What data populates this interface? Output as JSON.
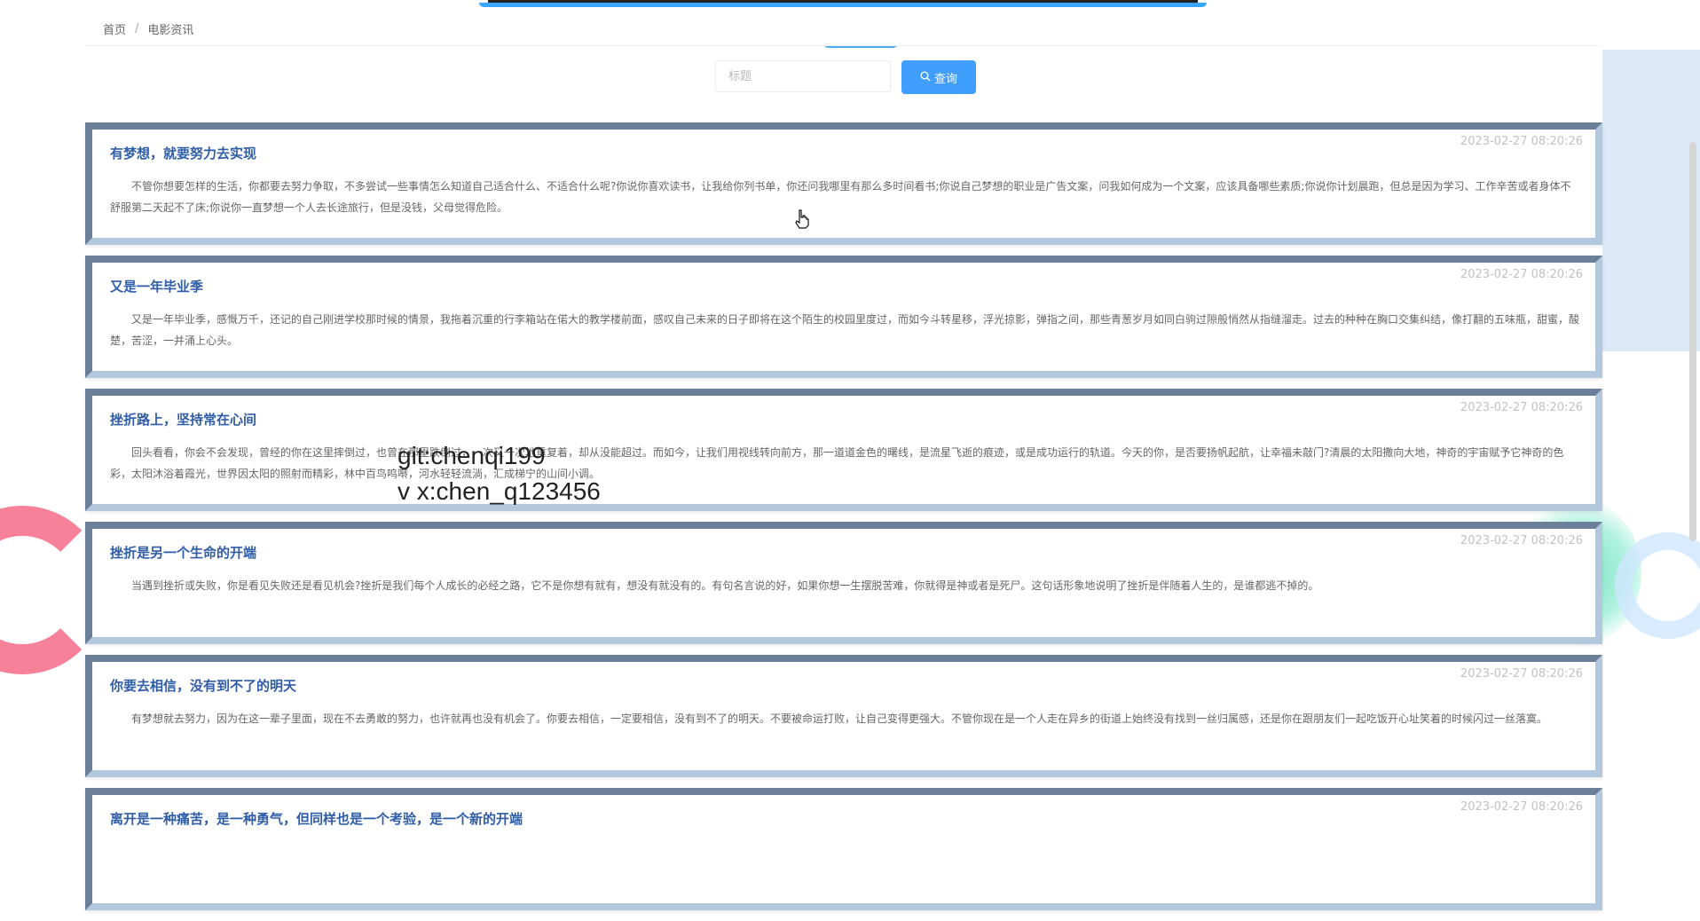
{
  "breadcrumb": {
    "home": "首页",
    "separator": "/",
    "current": "电影资讯"
  },
  "search": {
    "placeholder": "标题",
    "button_label": "查询",
    "button_icon": "search-icon"
  },
  "articles": [
    {
      "title": "有梦想，就要努力去实现",
      "time": "2023-02-27 08:20:26",
      "summary": "不管你想要怎样的生活，你都要去努力争取，不多尝试一些事情怎么知道自己适合什么、不适合什么呢?你说你喜欢读书，让我给你列书单，你还问我哪里有那么多时间看书;你说自己梦想的职业是广告文案，问我如何成为一个文案，应该具备哪些素质;你说你计划晨跑，但总是因为学习、工作辛苦或者身体不舒服第二天起不了床;你说你一直梦想一个人去长途旅行，但是没钱，父母觉得危险。"
    },
    {
      "title": "又是一年毕业季",
      "time": "2023-02-27 08:20:26",
      "summary": "又是一年毕业季，感慨万千，还记的自己刚进学校那时候的情景，我拖着沉重的行李箱站在偌大的教学楼前面，感叹自己未来的日子即将在这个陌生的校园里度过，而如今斗转星移，浮光掠影，弹指之间，那些青葱岁月如同白驹过隙般悄然从指缝溜走。过去的种种在胸口交集纠结，像打翻的五味瓶，甜蜜，酸楚，苦涩，一并涌上心头。"
    },
    {
      "title": "挫折路上，坚持常在心间",
      "time": "2023-02-27 08:20:26",
      "summary": "回头看看，你会不会发现，曾经的你在这里摔倒过，也曾在那里跌倒过，一次又一次地重复着，却从没能超过。而如今，让我们用视线转向前方，那一道道金色的曙线，是流星飞逝的痕迹，或是成功运行的轨道。今天的你，是否要扬帆起航，让幸福未敲门?清晨的太阳撒向大地，神奇的宇宙赋予它神奇的色彩，太阳沐浴着霞光，世界因太阳的照射而精彩，林中百鸟鸣啭，河水轻轻流淌，汇成梯宁的山间小调。"
    },
    {
      "title": "挫折是另一个生命的开端",
      "time": "2023-02-27 08:20:26",
      "summary": "当遇到挫折或失败，你是看见失败还是看见机会?挫折是我们每个人成长的必经之路，它不是你想有就有，想没有就没有的。有句名言说的好，如果你想一生摆脱苦难，你就得是神或者是死尸。这句话形象地说明了挫折是伴随着人生的，是谁都逃不掉的。"
    },
    {
      "title": "你要去相信，没有到不了的明天",
      "time": "2023-02-27 08:20:26",
      "summary": "有梦想就去努力，因为在这一辈子里面，现在不去勇敢的努力，也许就再也没有机会了。你要去相信，一定要相信，没有到不了的明天。不要被命运打败，让自己变得更强大。不管你现在是一个人走在异乡的街道上始终没有找到一丝归属感，还是你在跟朋友们一起吃饭开心址笑着的时候闪过一丝落寞。"
    },
    {
      "title": "离开是一种痛苦，是一种勇气，但同样也是一个考验，是一个新的开端",
      "time": "2023-02-27 08:20:26",
      "summary": ""
    }
  ],
  "watermark": {
    "line1": "git:chenqi199",
    "line2": "v x:chen_q123456"
  },
  "colors": {
    "accent": "#409eff",
    "title": "#2f5da8",
    "card_border_dark": "#6c7f98",
    "card_border_light": "#b3c7dd"
  }
}
